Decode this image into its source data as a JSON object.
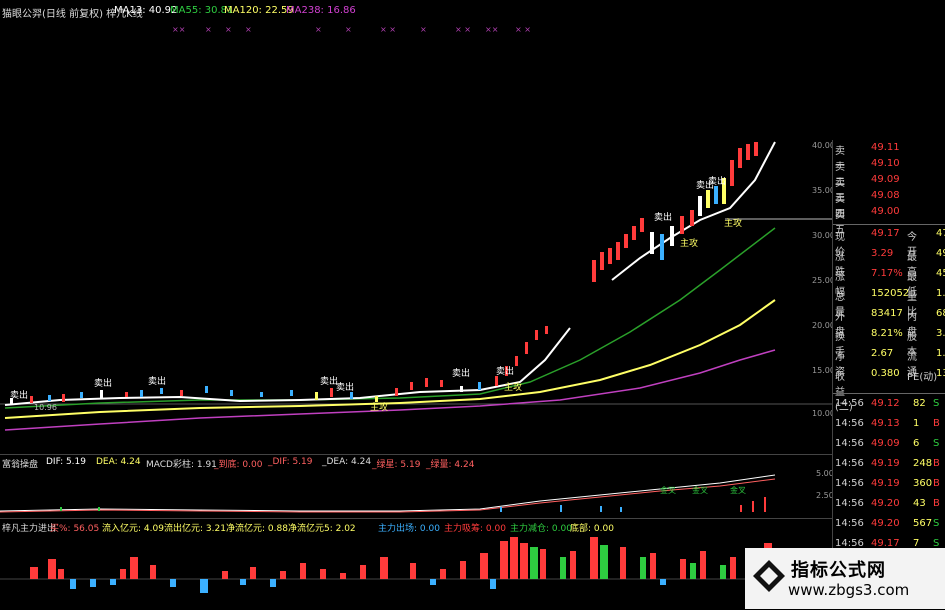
{
  "top_bar": {
    "title": "猫眼公羿(日线 前复权) 梓几K线",
    "ma13": "MA13: 40.92",
    "ma55": "MA55: 30.81",
    "ma120": "MA120: 22.59",
    "ma238": "MA238: 16.86"
  },
  "price_axis": [
    "40.00",
    "35.00",
    "30.00",
    "25.00",
    "20.00",
    "15.00",
    "10.00"
  ],
  "chart_labels": {
    "sell_tag": "卖出",
    "attack_tag": "主攻",
    "low_marker": "10.96"
  },
  "quote": {
    "rows": [
      {
        "label": "卖一",
        "value": "49.11",
        "label2": "",
        "value2": ""
      },
      {
        "label": "卖二",
        "value": "49.10",
        "label2": "",
        "value2": ""
      },
      {
        "label": "卖三",
        "value": "49.09",
        "label2": "",
        "value2": ""
      },
      {
        "label": "卖四",
        "value": "49.08",
        "label2": "",
        "value2": ""
      },
      {
        "label": "卖五",
        "value": "49.00",
        "label2": "",
        "value2": ""
      }
    ],
    "stats": [
      {
        "label": "现价",
        "value": "49.17",
        "label2": "今开",
        "value2": "47"
      },
      {
        "label": "涨跌",
        "value": "3.29",
        "label2": "最高",
        "value2": "49"
      },
      {
        "label": "涨幅",
        "value": "7.17%",
        "label2": "最低",
        "value2": "45"
      },
      {
        "label": "总量",
        "value": "152052",
        "label2": "量比",
        "value2": "1."
      },
      {
        "label": "外盘",
        "value": "83417",
        "label2": "内盘",
        "value2": "68"
      },
      {
        "label": "换手",
        "value": "8.21%",
        "label2": "股本",
        "value2": "3.0"
      },
      {
        "label": "净资",
        "value": "2.67",
        "label2": "流通",
        "value2": "1.8"
      },
      {
        "label": "收益(二)",
        "value": "0.380",
        "label2": "PE(动)",
        "value2": "13"
      }
    ],
    "ticks": [
      {
        "time": "14:56",
        "price": "49.12",
        "vol": "82",
        "side": "S"
      },
      {
        "time": "14:56",
        "price": "49.13",
        "vol": "1",
        "side": "B"
      },
      {
        "time": "14:56",
        "price": "49.09",
        "vol": "6",
        "side": "S"
      },
      {
        "time": "14:56",
        "price": "49.19",
        "vol": "248",
        "side": "B"
      },
      {
        "time": "14:56",
        "price": "49.19",
        "vol": "360",
        "side": "B"
      },
      {
        "time": "14:56",
        "price": "49.20",
        "vol": "43",
        "side": "B"
      },
      {
        "time": "14:56",
        "price": "49.20",
        "vol": "567",
        "side": "S"
      },
      {
        "time": "14:56",
        "price": "49.17",
        "vol": "7",
        "side": "S"
      }
    ]
  },
  "macd_header": {
    "name": "富翁操盘",
    "dif": "DIF: 5.19",
    "dea": "DEA: 4.24",
    "macd": "MACD彩柱: 1.91",
    "k1": "_到底: 0.00",
    "k2": "_DIF: 5.19",
    "k3": "_DEA: 4.24",
    "k4": "_绿星: 5.19",
    "k5": "_绿量: 4.24",
    "axis_top": "5.00",
    "axis_mid": "2.50"
  },
  "flow_header": {
    "name": "梓凡主力进出",
    "f1": "买%: 56.05",
    "f2": "流入亿元: 4.09",
    "f3": "流出亿元: 3.21",
    "f4": "净流亿元: 0.88",
    "f5": "净流亿元5: 2.02",
    "f6": "主力出场: 0.00",
    "f7": "主力吸筹: 0.00",
    "f8": "主力减仓: 0.00",
    "f9": "底部: 0.00"
  },
  "watermark": {
    "title": "指标公式网",
    "url": "www.zbgs3.com"
  },
  "colors": {
    "up": "#ff3b3b",
    "down": "#3bb0ff",
    "green": "#2ecc40",
    "yellow": "#ffff66",
    "magenta": "#d040d0",
    "white": "#ffffff"
  }
}
